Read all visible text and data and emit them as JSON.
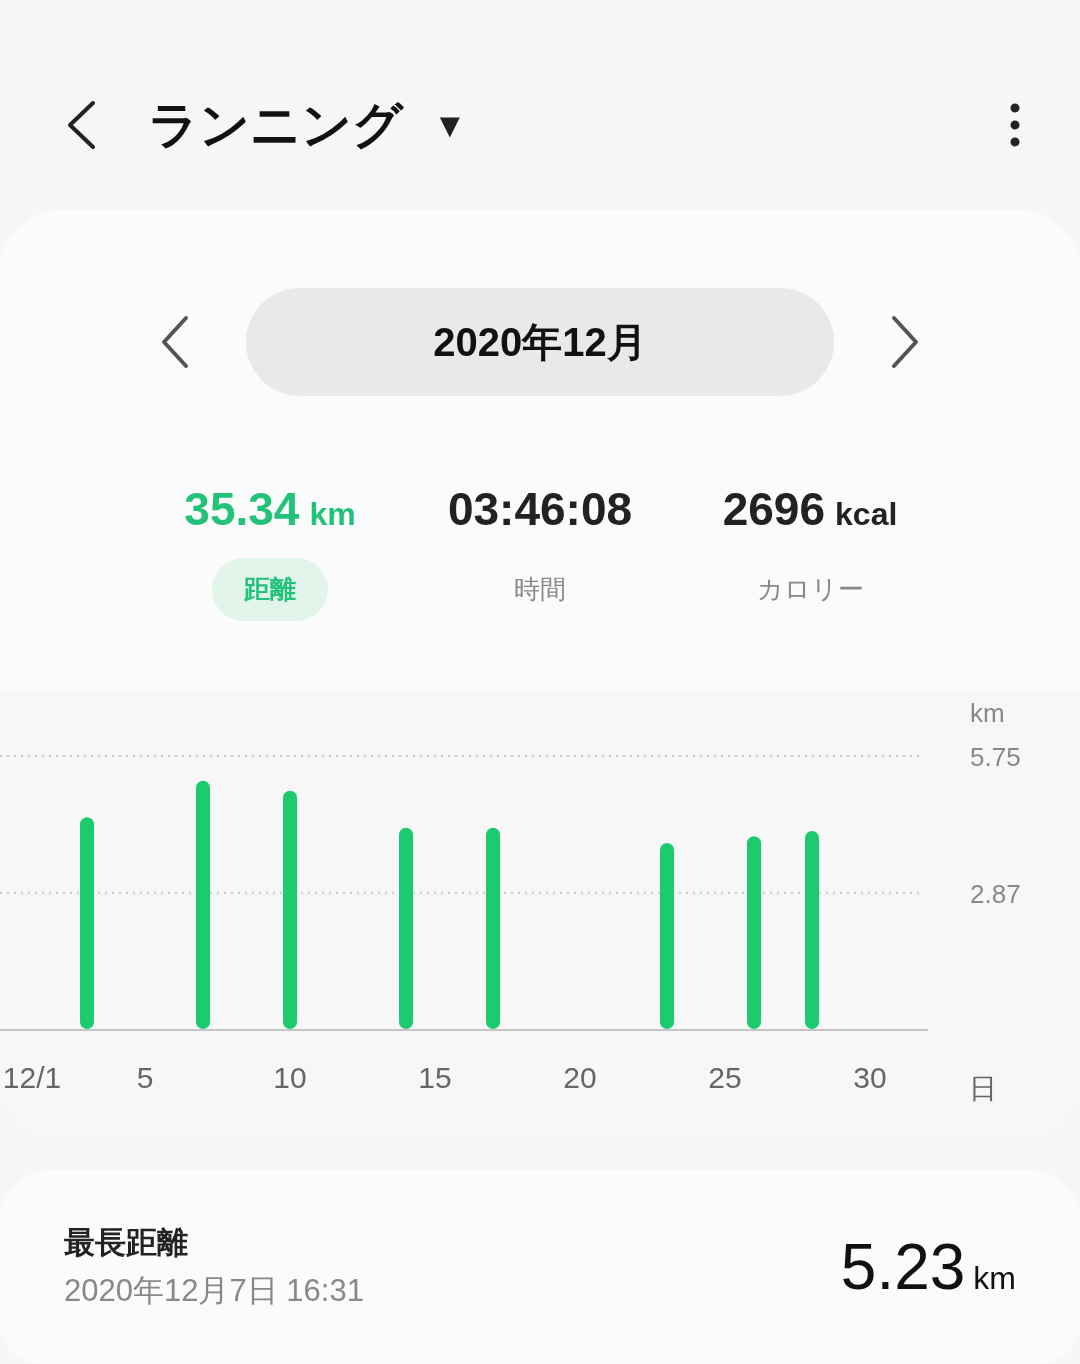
{
  "header": {
    "title": "ランニング",
    "dropdown": "▼"
  },
  "month_nav": {
    "label": "2020年12月"
  },
  "stats": [
    {
      "value": "35.34",
      "unit": "km",
      "label": "距離",
      "selected": true
    },
    {
      "value": "03:46:08",
      "label": "時間",
      "selected": false
    },
    {
      "value": "2696",
      "unit": "kcal",
      "label": "カロリー",
      "selected": false
    }
  ],
  "chart": {
    "chart_data": {
      "type": "bar",
      "ylabel": "km",
      "xlabel": "日",
      "x": [
        3,
        7,
        10,
        14,
        17,
        23,
        26,
        28
      ],
      "series": [
        {
          "color": "#1ccb6e",
          "values": [
            4.46,
            5.23,
            5.02,
            4.24,
            4.24,
            3.92,
            4.06,
            4.17
          ]
        }
      ],
      "xlim": [
        0,
        32
      ],
      "ylim": [
        0,
        5.75
      ],
      "yticks": [
        2.87,
        5.75
      ],
      "xticks": [
        {
          "value": 1,
          "label": "12/1"
        },
        {
          "value": 5,
          "label": "5"
        },
        {
          "value": 10,
          "label": "10"
        },
        {
          "value": 15,
          "label": "15"
        },
        {
          "value": 20,
          "label": "20"
        },
        {
          "value": 25,
          "label": "25"
        },
        {
          "value": 30,
          "label": "30"
        }
      ]
    }
  },
  "record": {
    "title": "最長距離",
    "date": "2020年12月7日 16:31",
    "value": "5.23",
    "unit": "km"
  }
}
